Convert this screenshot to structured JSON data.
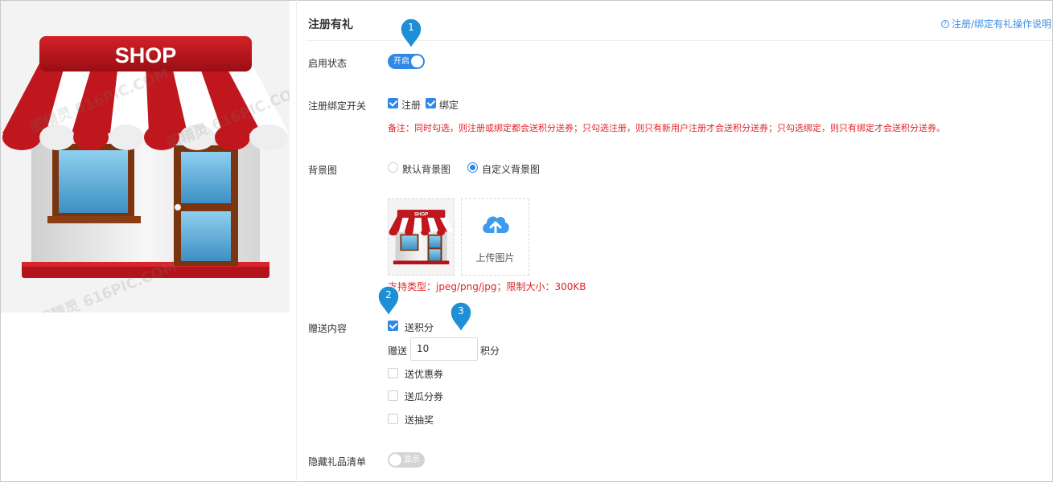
{
  "panel": {
    "title": "注册有礼",
    "help_link": "注册/绑定有礼操作说明"
  },
  "preview": {
    "shop_sign": "SHOP",
    "watermark": "图精灵 616PIC.COM"
  },
  "status": {
    "label": "启用状态",
    "switch_text": "开启",
    "enabled": true
  },
  "register_bind": {
    "label": "注册绑定开关",
    "options": [
      {
        "label": "注册",
        "checked": true
      },
      {
        "label": "绑定",
        "checked": true
      }
    ],
    "note": "备注：同时勾选，则注册或绑定都会送积分送券；只勾选注册，则只有新用户注册才会送积分送券；只勾选绑定，则只有绑定才会送积分送券。"
  },
  "background": {
    "label": "背景图",
    "options": [
      {
        "label": "默认背景图",
        "selected": false
      },
      {
        "label": "自定义背景图",
        "selected": true
      }
    ],
    "upload_label": "上传图片",
    "support_text": "支持类型：jpeg/png/jpg；限制大小：300KB"
  },
  "gift": {
    "label": "赠送内容",
    "points": {
      "label": "送积分",
      "checked": true,
      "prefix": "赠送",
      "value": "10",
      "suffix": "积分"
    },
    "items": [
      {
        "label": "送优惠券",
        "checked": false
      },
      {
        "label": "送瓜分券",
        "checked": false
      },
      {
        "label": "送抽奖",
        "checked": false
      }
    ]
  },
  "hide_gift": {
    "label": "隐藏礼品清单",
    "switch_text": "显示",
    "enabled": false
  },
  "markers": [
    "1",
    "2",
    "3"
  ],
  "colors": {
    "accent": "#2f87e6",
    "warning": "#e0242a",
    "awning_red": "#c0161d"
  }
}
